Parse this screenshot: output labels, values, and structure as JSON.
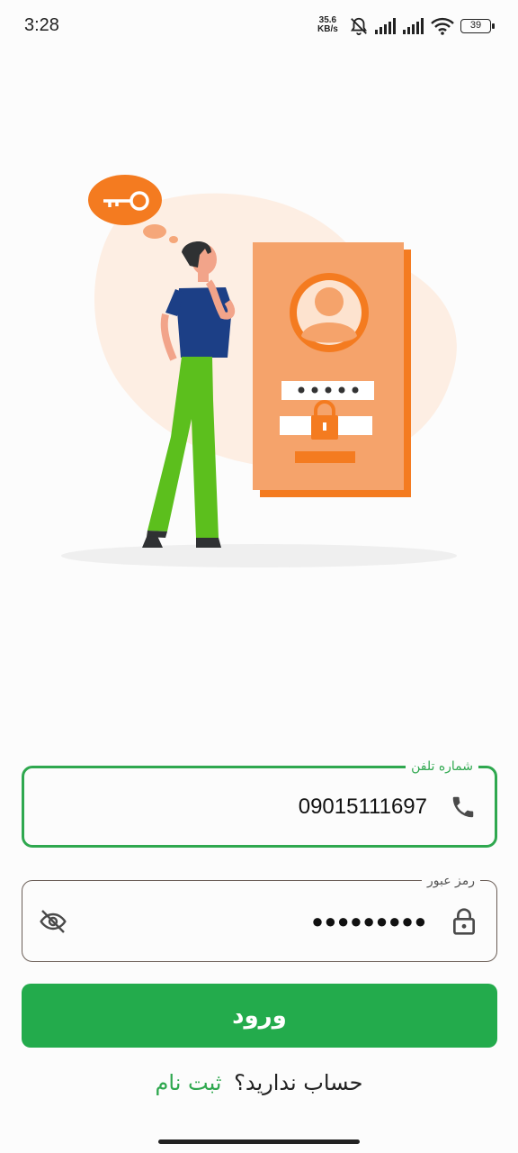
{
  "status_bar": {
    "time": "3:28",
    "net_speed_value": "35.6",
    "net_speed_unit": "KB/s",
    "battery_level": "39",
    "icons": [
      "bell-off-icon",
      "signal-icon",
      "signal-icon",
      "wifi-icon",
      "battery-icon"
    ]
  },
  "illustration": {
    "description_icon": "login-illustration"
  },
  "phone_field": {
    "label": "شماره تلفن",
    "value": "09015111697",
    "icon": "phone-icon"
  },
  "password_field": {
    "label": "رمز عبور",
    "value": "●●●●●●●●●",
    "icon": "lock-icon",
    "toggle_icon": "eye-off-icon"
  },
  "login_button": {
    "label": "ورود"
  },
  "signup": {
    "question": "حساب ندارید؟",
    "link": "ثبت نام"
  },
  "colors": {
    "accent": "#2fa84f",
    "button": "#23ab4c",
    "illustration_orange": "#f47b20"
  }
}
